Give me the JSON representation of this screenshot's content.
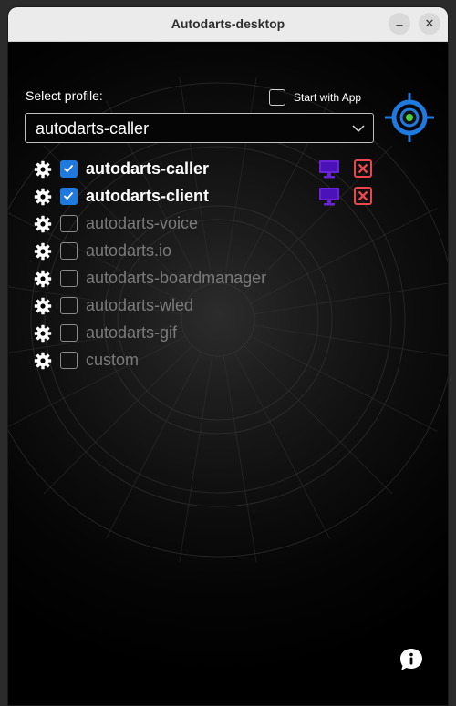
{
  "window": {
    "title": "Autodarts-desktop"
  },
  "titlebar_buttons": {
    "minimize": "–",
    "close": "✕"
  },
  "header": {
    "select_profile_label": "Select profile:",
    "start_with_app_label": "Start with App",
    "start_with_app_checked": false
  },
  "profile_select": {
    "value": "autodarts-caller"
  },
  "apps": [
    {
      "name": "autodarts-caller",
      "checked": true,
      "active": true
    },
    {
      "name": "autodarts-client",
      "checked": true,
      "active": true
    },
    {
      "name": "autodarts-voice",
      "checked": false,
      "active": false
    },
    {
      "name": "autodarts.io",
      "checked": false,
      "active": false
    },
    {
      "name": "autodarts-boardmanager",
      "checked": false,
      "active": false
    },
    {
      "name": "autodarts-wled",
      "checked": false,
      "active": false
    },
    {
      "name": "autodarts-gif",
      "checked": false,
      "active": false
    },
    {
      "name": "custom",
      "checked": false,
      "active": false
    }
  ],
  "colors": {
    "checkbox_checked": "#1f7ae0",
    "monitor_icon": "#6a22d6",
    "close_icon": "#e8474f",
    "logo_ring": "#1f7ae0",
    "logo_center": "#4cd137"
  },
  "icons": {
    "settings": "gear-icon",
    "monitor": "monitor-icon",
    "stop": "close-x-icon",
    "info": "info-bubble-icon",
    "logo": "autodarts-target-logo"
  }
}
